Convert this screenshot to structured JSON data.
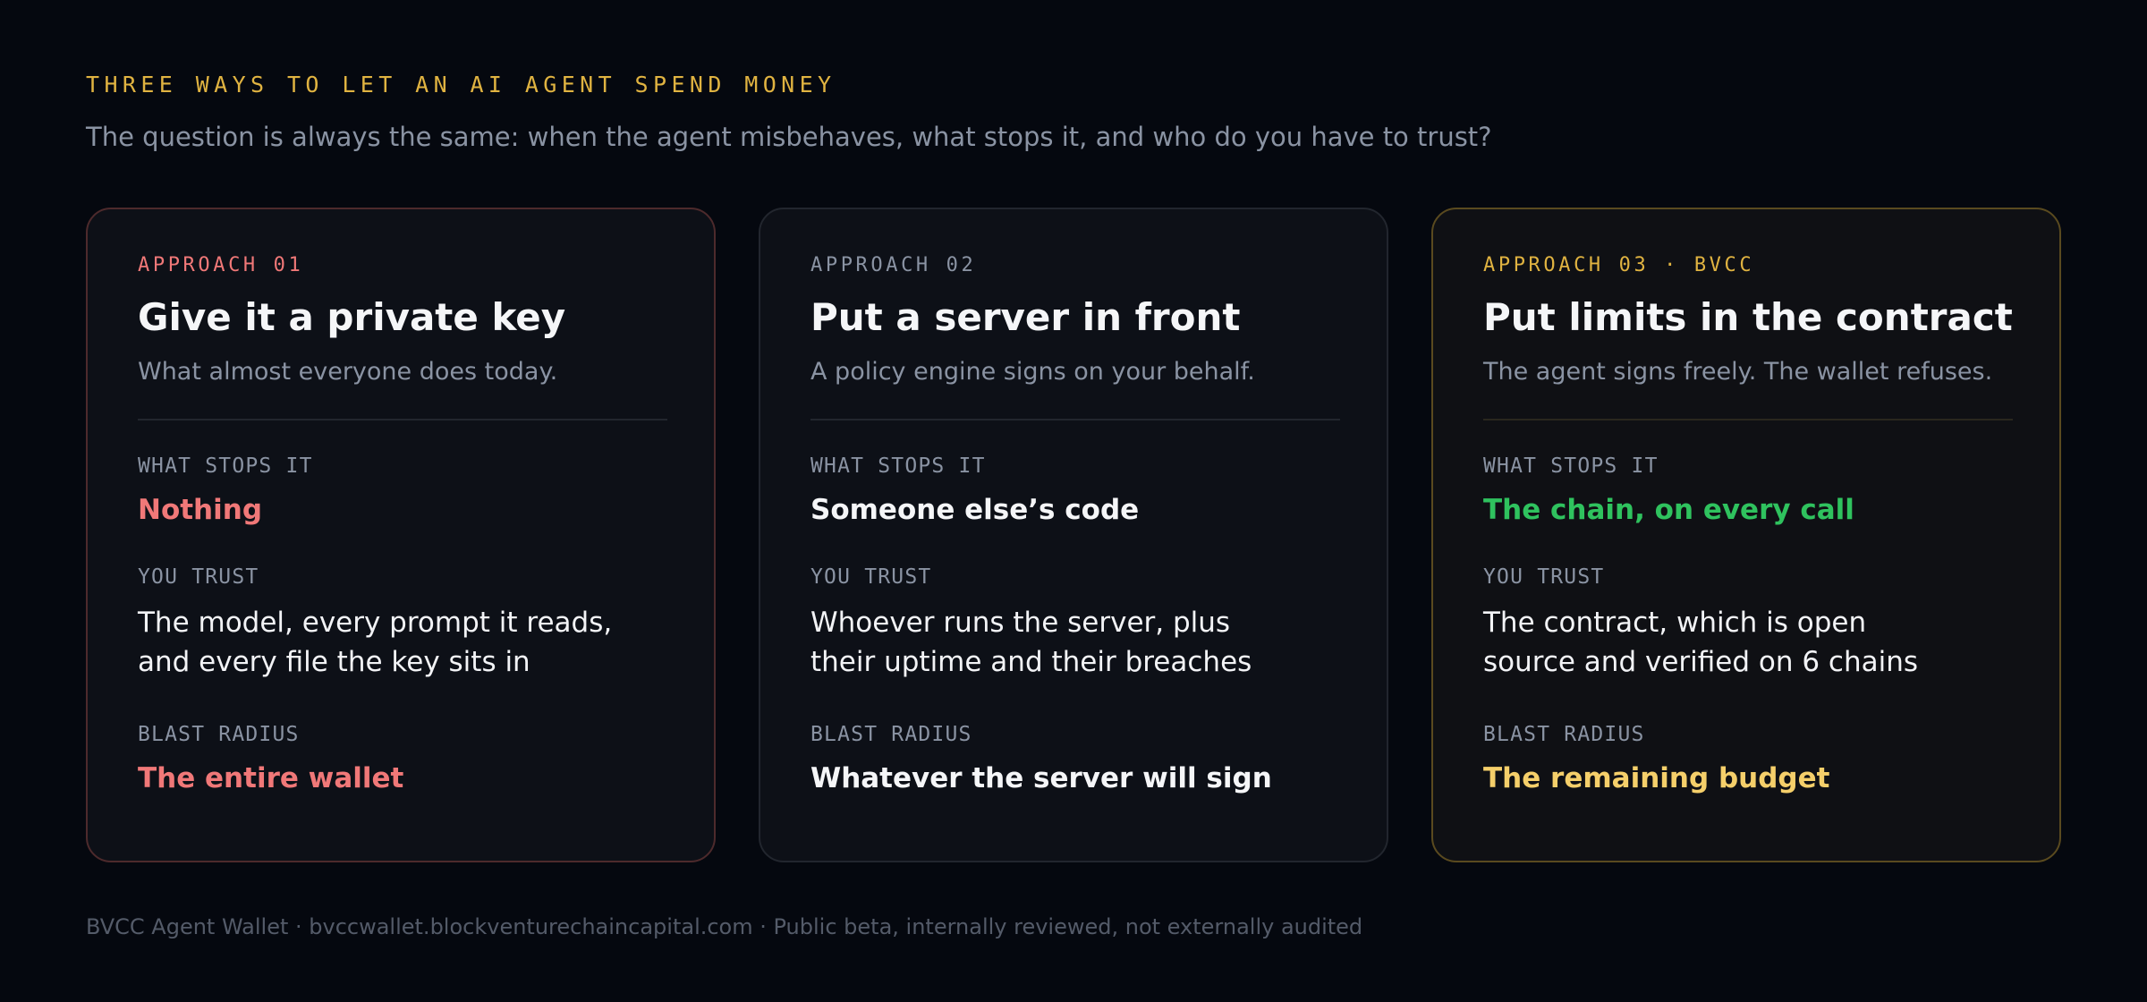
{
  "header": {
    "eyebrow": "THREE WAYS TO LET AN AI AGENT SPEND MONEY",
    "subtitle": "The question is always the same: when the agent misbehaves, what stops it, and who do you have to trust?"
  },
  "labels": {
    "what_stops_it": "WHAT STOPS IT",
    "you_trust": "YOU TRUST",
    "blast_radius": "BLAST RADIUS"
  },
  "cards": [
    {
      "tag": "APPROACH 01",
      "title": "Give it a private key",
      "lede": "What almost everyone does today.",
      "what_stops_it": "Nothing",
      "you_trust_line1": "The model, every prompt it reads,",
      "you_trust_line2": "and every file the key sits in",
      "blast_radius": "The entire wallet",
      "accent": "#f07878",
      "border": "#4d2a2c"
    },
    {
      "tag": "APPROACH 02",
      "title": "Put a server in front",
      "lede": "A policy engine signs on your behalf.",
      "what_stops_it": "Someone else’s code",
      "you_trust_line1": "Whoever runs the server, plus",
      "you_trust_line2": "their uptime and their breaches",
      "blast_radius": "Whatever the server will sign",
      "accent": "#f5f6f8",
      "border": "#22262e"
    },
    {
      "tag": "APPROACH 03 · BVCC",
      "title": "Put limits in the contract",
      "lede": "The agent signs freely. The wallet refuses.",
      "what_stops_it": "The chain, on every call",
      "you_trust_line1": "The contract, which is open",
      "you_trust_line2": "source and verified on 6 chains",
      "blast_radius": "The remaining budget",
      "accent_stops": "#2fc25e",
      "accent_blast": "#f5cf6a",
      "border": "#5a4a1f"
    }
  ],
  "footer": {
    "text": "BVCC Agent Wallet · bvccwallet.blockventurechaincapital.com · Public beta, internally reviewed, not externally audited"
  }
}
